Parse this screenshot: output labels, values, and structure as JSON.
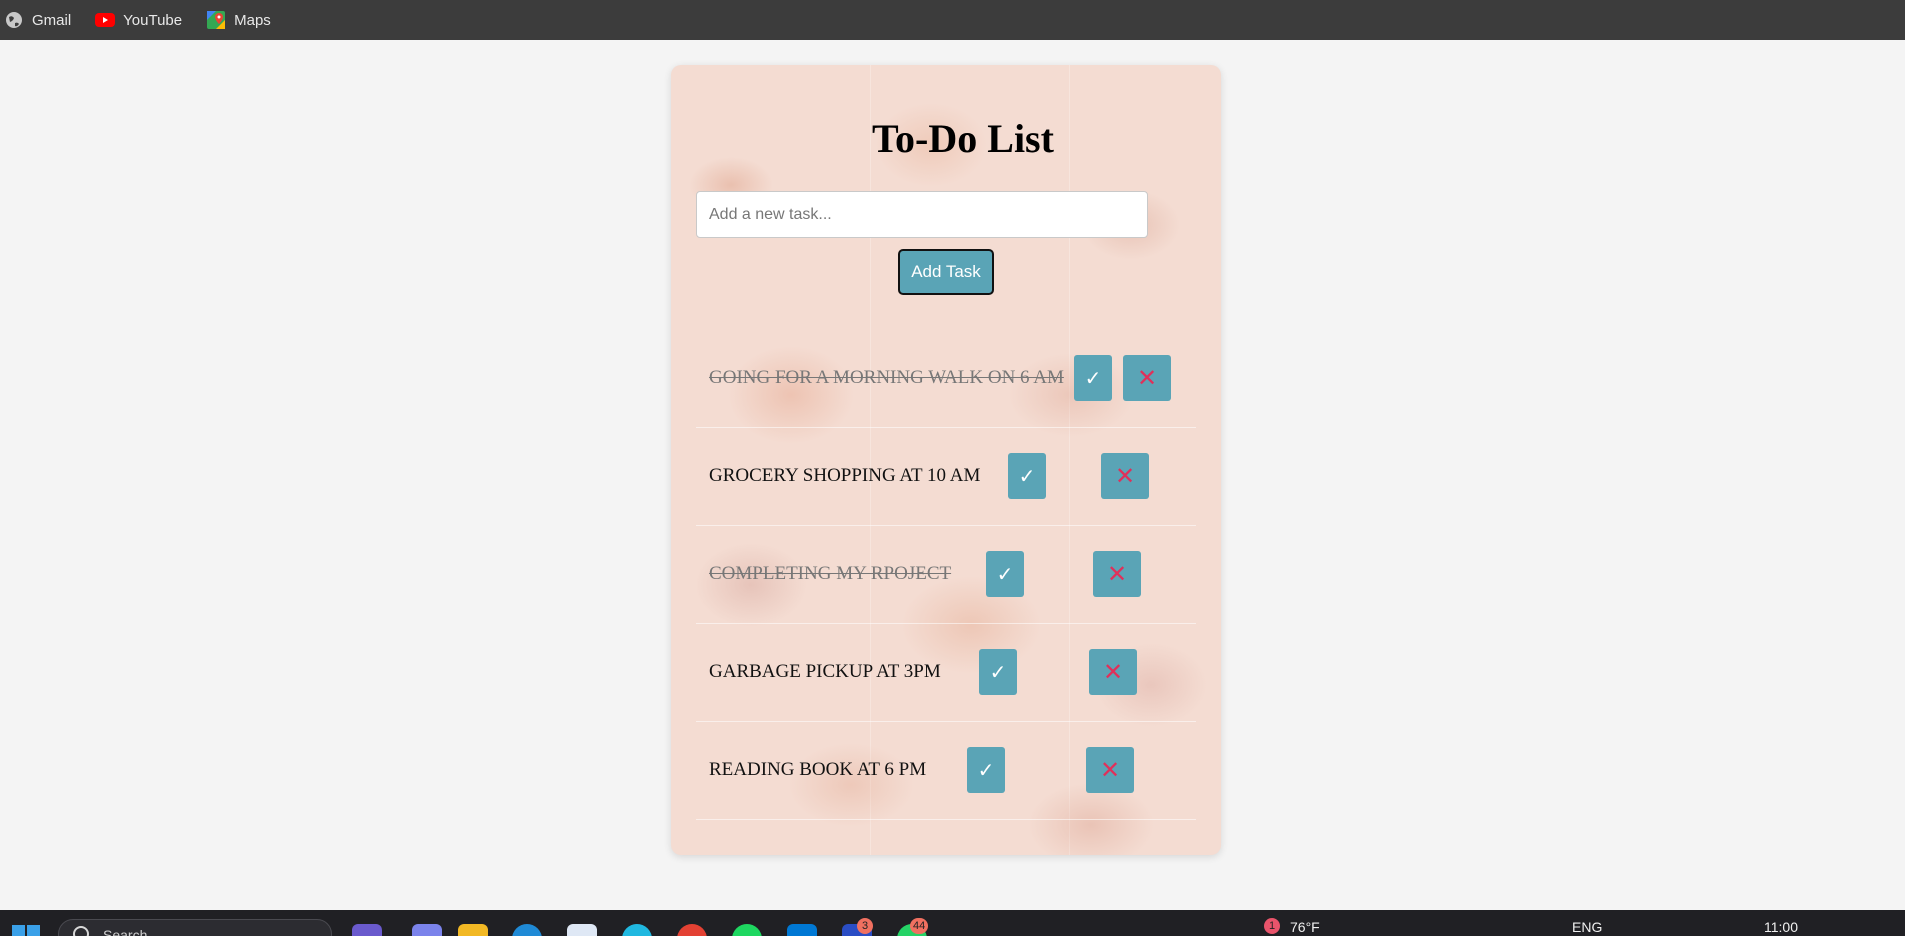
{
  "bookmarks": [
    {
      "label": "Gmail",
      "icon": "globe-icon"
    },
    {
      "label": "YouTube",
      "icon": "youtube-icon"
    },
    {
      "label": "Maps",
      "icon": "maps-icon"
    }
  ],
  "app": {
    "title": "To-Do List",
    "input_placeholder": "Add a new task...",
    "input_value": "",
    "add_button_label": "Add Task",
    "check_symbol": "✓",
    "delete_symbol": "✕",
    "colors": {
      "button_bg": "#5aa4b6",
      "delete_icon": "#e0305a",
      "done_text": "#777777"
    },
    "tasks": [
      {
        "text": "GOING FOR A MORNING WALK ON 6 AM",
        "done": true
      },
      {
        "text": "GROCERY SHOPPING AT 10 AM",
        "done": false
      },
      {
        "text": "COMPLETING MY RPOJECT",
        "done": true
      },
      {
        "text": "GARBAGE PICKUP AT 3PM",
        "done": false
      },
      {
        "text": "READING BOOK AT 6 PM",
        "done": false
      }
    ]
  },
  "taskbar": {
    "search_placeholder": "Search",
    "badges": {
      "app_a": "3",
      "app_b": "44",
      "weather": "1"
    },
    "weather": "76°F",
    "language": "ENG",
    "time": "11:00"
  }
}
